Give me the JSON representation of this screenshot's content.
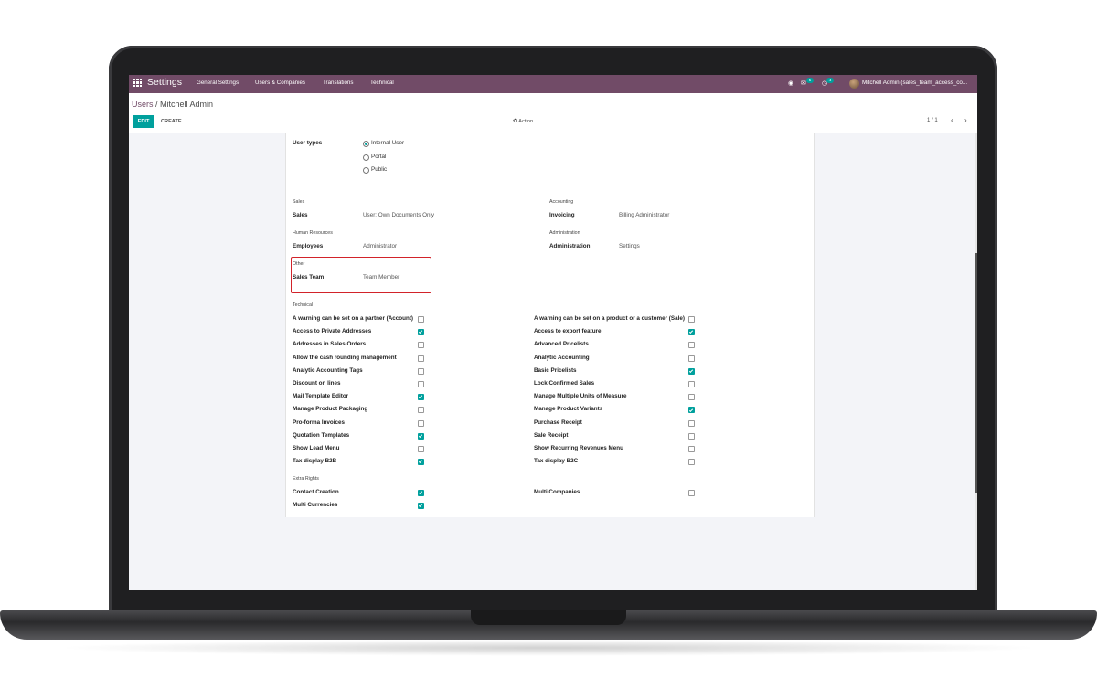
{
  "topbar": {
    "app_name": "Settings",
    "menu": [
      "General Settings",
      "Users & Companies",
      "Translations",
      "Technical"
    ],
    "messages_count": "5",
    "activities_count": "4",
    "user": "Mitchell Admin (sales_team_access_co..."
  },
  "controlbar": {
    "breadcrumb_parent": "Users",
    "breadcrumb_sep": " / ",
    "breadcrumb_current": "Mitchell Admin",
    "edit": "EDIT",
    "create": "CREATE",
    "action": "✿ Action",
    "pager": "1 / 1",
    "prev": "‹",
    "next": "›"
  },
  "user_types": {
    "label": "User types",
    "options": [
      "Internal User",
      "Portal",
      "Public"
    ],
    "selected": "Internal User"
  },
  "groups": {
    "sales": {
      "title": "Sales",
      "label": "Sales",
      "value": "User: Own Documents Only"
    },
    "accounting": {
      "title": "Accounting",
      "label": "Invoicing",
      "value": "Billing Administrator"
    },
    "hr": {
      "title": "Human Resources",
      "label": "Employees",
      "value": "Administrator"
    },
    "administration": {
      "title": "Administration",
      "label": "Administration",
      "value": "Settings"
    },
    "other": {
      "title": "Other",
      "label": "Sales Team",
      "value": "Team Member"
    }
  },
  "technical": {
    "title": "Technical",
    "left": [
      {
        "label": "A warning can be set on a partner (Account)",
        "checked": false
      },
      {
        "label": "Access to Private Addresses",
        "checked": true
      },
      {
        "label": "Addresses in Sales Orders",
        "checked": false
      },
      {
        "label": "Allow the cash rounding management",
        "checked": false
      },
      {
        "label": "Analytic Accounting Tags",
        "checked": false
      },
      {
        "label": "Discount on lines",
        "checked": false
      },
      {
        "label": "Mail Template Editor",
        "checked": true
      },
      {
        "label": "Manage Product Packaging",
        "checked": false
      },
      {
        "label": "Pro-forma Invoices",
        "checked": false
      },
      {
        "label": "Quotation Templates",
        "checked": true
      },
      {
        "label": "Show Lead Menu",
        "checked": false
      },
      {
        "label": "Tax display B2B",
        "checked": true
      }
    ],
    "right": [
      {
        "label": "A warning can be set on a product or a customer (Sale)",
        "checked": false
      },
      {
        "label": "Access to export feature",
        "checked": true
      },
      {
        "label": "Advanced Pricelists",
        "checked": false
      },
      {
        "label": "Analytic Accounting",
        "checked": false
      },
      {
        "label": "Basic Pricelists",
        "checked": true
      },
      {
        "label": "Lock Confirmed Sales",
        "checked": false
      },
      {
        "label": "Manage Multiple Units of Measure",
        "checked": false
      },
      {
        "label": "Manage Product Variants",
        "checked": true
      },
      {
        "label": "Purchase Receipt",
        "checked": false
      },
      {
        "label": "Sale Receipt",
        "checked": false
      },
      {
        "label": "Show Recurring Revenues Menu",
        "checked": false
      },
      {
        "label": "Tax display B2C",
        "checked": false
      }
    ]
  },
  "extra_rights": {
    "title": "Extra Rights",
    "left": [
      {
        "label": "Contact Creation",
        "checked": true
      },
      {
        "label": "Multi Currencies",
        "checked": true
      }
    ],
    "right": [
      {
        "label": "Multi Companies",
        "checked": false
      }
    ]
  },
  "colors": {
    "brand": "#714b67",
    "accent": "#00a09d",
    "highlight": "#d2232a"
  }
}
